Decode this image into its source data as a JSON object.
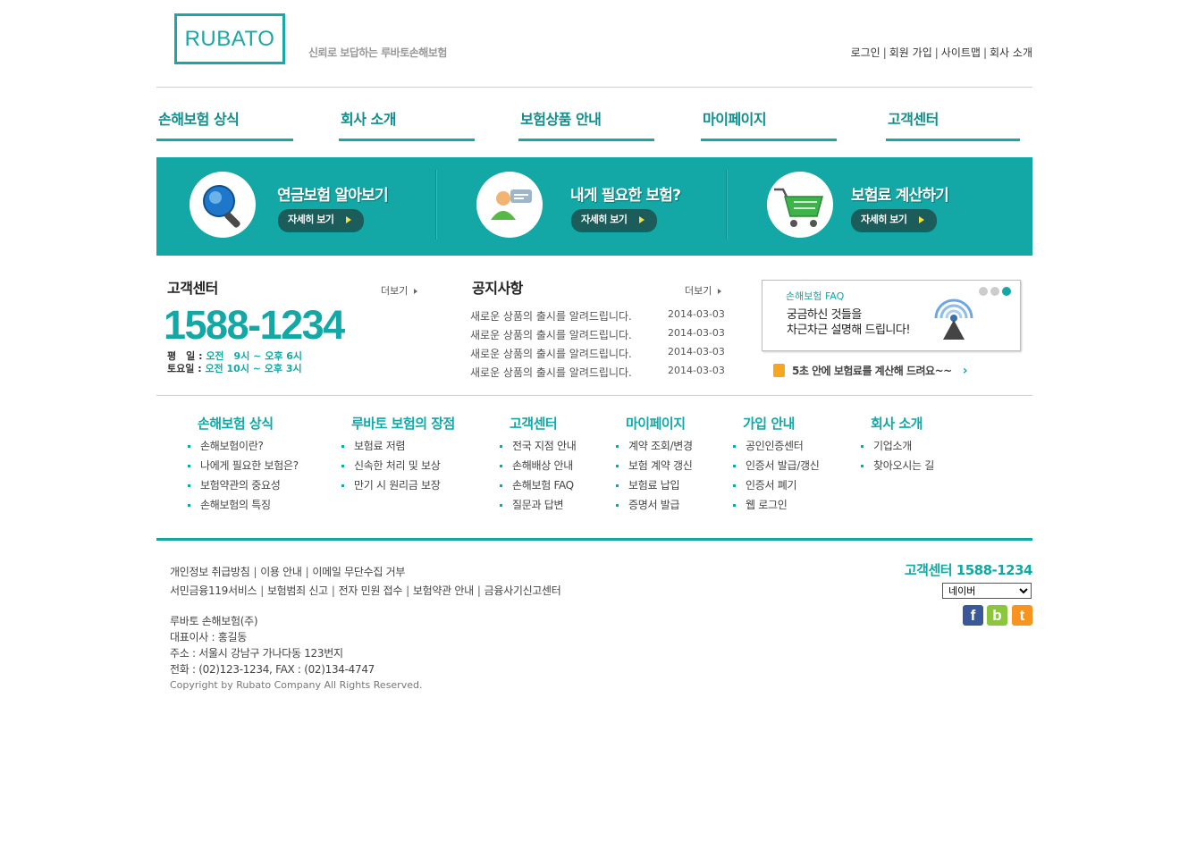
{
  "header": {
    "logo": "RUBATO",
    "slogan": "신뢰로 보답하는 루바토손해보험",
    "toplinks": [
      "로그인",
      "회원 가입",
      "사이트맵",
      "회사 소개"
    ]
  },
  "gnb": [
    "손해보험 상식",
    "회사 소개",
    "보험상품 안내",
    "마이페이지",
    "고객센터"
  ],
  "banner": {
    "items": [
      {
        "title": "연금보험 알아보기",
        "button": "자세히 보기",
        "icon": "magnifier-icon"
      },
      {
        "title": "내게 필요한 보험?",
        "button": "자세히 보기",
        "icon": "person-chat-icon"
      },
      {
        "title": "보험료 계산하기",
        "button": "자세히 보기",
        "icon": "shopping-cart-icon"
      }
    ]
  },
  "customer_center": {
    "title": "고객센터",
    "more": "더보기",
    "phone": "1588-1234",
    "weekday_label": "평　일 :",
    "weekday_hours": "오전　9시 ~ 오후 6시",
    "saturday_label": "토요일 :",
    "saturday_hours": "오전 10시 ~ 오후 3시"
  },
  "notice": {
    "title": "공지사항",
    "more": "더보기",
    "items": [
      {
        "text": "새로운 상품의 출시를 알려드립니다.",
        "date": "2014-03-03"
      },
      {
        "text": "새로운 상품의 출시를 알려드립니다.",
        "date": "2014-03-03"
      },
      {
        "text": "새로운 상품의 출시를 알려드립니다.",
        "date": "2014-03-03"
      },
      {
        "text": "새로운 상품의 출시를 알려드립니다.",
        "date": "2014-03-03"
      }
    ]
  },
  "faq": {
    "label": "손해보험 FAQ",
    "line1": "궁금하신 것들을",
    "line2": "차근차근 설명해 드립니다!",
    "icon": "broadcast-tower-icon"
  },
  "calc_link": "5초 안에 보험료를 계산해 드려요~~",
  "sitemap": [
    {
      "title": "손해보험 상식",
      "items": [
        "손해보험이란?",
        "나에게 필요한 보험은?",
        "보험약관의 중요성",
        "손해보험의 특징"
      ]
    },
    {
      "title": "루바토 보험의 장점",
      "items": [
        "보험료 저렴",
        "신속한 처리 및 보상",
        "만기 시 원리금 보장"
      ]
    },
    {
      "title": "고객센터",
      "items": [
        "전국 지점 안내",
        "손해배상 안내",
        "손해보험 FAQ",
        "질문과 답변"
      ]
    },
    {
      "title": "마이페이지",
      "items": [
        "계약 조회/변경",
        "보험 계약 갱신",
        "보험료 납입",
        "증명서 발급"
      ]
    },
    {
      "title": "가입 안내",
      "items": [
        "공인인증센터",
        "인증서 발급/갱신",
        "인증서 폐기",
        "웹 로그인"
      ]
    },
    {
      "title": "회사 소개",
      "items": [
        "기업소개",
        "찾아오시는 길"
      ]
    }
  ],
  "footer": {
    "links1": [
      "개인정보 취급방침",
      "이용 안내",
      "이메일 무단수집 거부"
    ],
    "links2": [
      "서민금융119서비스",
      "보험범죄 신고",
      "전자 민원 접수",
      "보험약관 안내",
      "금융사기신고센터"
    ],
    "company": "루바토 손해보험(주)",
    "ceo": "대표이사 : 홍길동",
    "address": "주소 : 서울시 강남구 가나다동 123번지",
    "phone": "전화 : (02)123-1234, FAX : (02)134-4747",
    "copyright": "Copyright by Rubato Company All Rights Reserved.",
    "cs": "고객센터 1588-1234",
    "select_value": "네이버",
    "sns": [
      {
        "letter": "f",
        "color": "#3b5998",
        "icon": "facebook-icon"
      },
      {
        "letter": "b",
        "color": "#8cc63f",
        "icon": "blog-icon"
      },
      {
        "letter": "t",
        "color": "#f7931e",
        "icon": "twitter-icon"
      }
    ]
  }
}
